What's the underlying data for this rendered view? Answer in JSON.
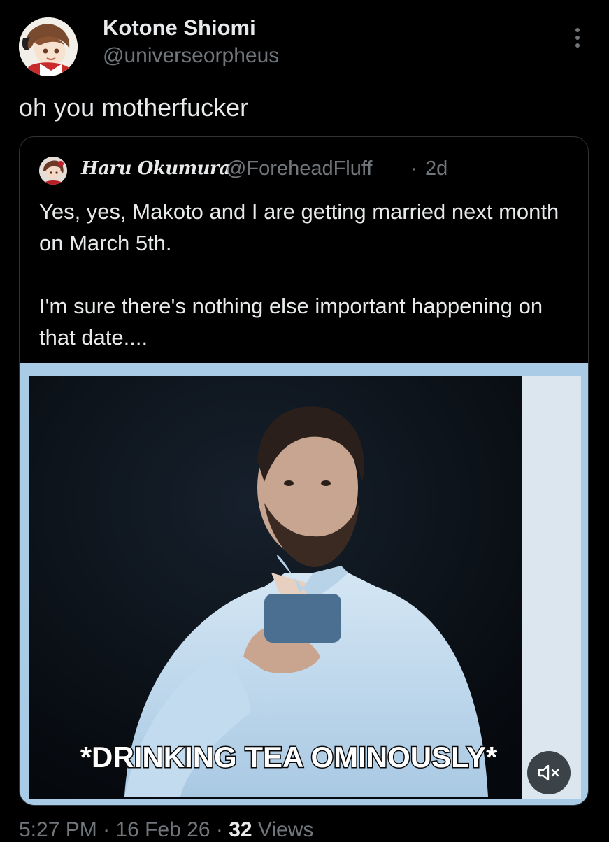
{
  "author": {
    "display_name": "Kotone Shiomi",
    "handle": "@universeorpheus",
    "avatar_icon": "anime-character-avatar"
  },
  "tweet": {
    "text": "oh you motherfucker",
    "more_icon": "vertical-ellipsis-icon"
  },
  "quote": {
    "display_name": "Haru Okumura",
    "handle": "@ForeheadFluff",
    "separator": "·",
    "time": "2d",
    "paragraphs": [
      "Yes, yes, Makoto and I are getting married next month on March 5th.",
      "I'm sure there's nothing else important happening on that date...."
    ],
    "media": {
      "caption": "*DRINKING TEA OMINOUSLY*",
      "mute_icon": "speaker-muted-icon",
      "border_color": "#a9cbe6"
    }
  },
  "meta": {
    "time": "5:27 PM",
    "sep1": " · ",
    "date": "16 Feb 26",
    "sep2": " · ",
    "views_count": "32",
    "views_label": " Views"
  },
  "colors": {
    "background": "#000000",
    "primary_text": "#e7e9ea",
    "secondary_text": "#71767b",
    "card_border": "#2f3336"
  }
}
